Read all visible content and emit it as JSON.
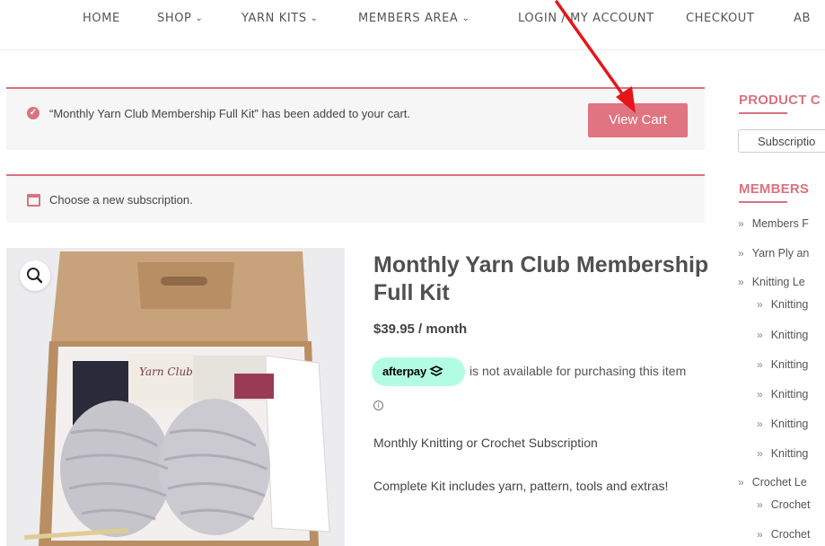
{
  "nav": {
    "items": [
      {
        "label": "HOME",
        "has_dropdown": false
      },
      {
        "label": "SHOP",
        "has_dropdown": true
      },
      {
        "label": "YARN KITS",
        "has_dropdown": true
      },
      {
        "label": "MEMBERS AREA",
        "has_dropdown": true
      },
      {
        "label": "LOGIN / MY ACCOUNT",
        "has_dropdown": false
      },
      {
        "label": "CHECKOUT",
        "has_dropdown": false
      },
      {
        "label": "AB",
        "has_dropdown": false
      }
    ],
    "dropdown_icon": "chevron-down-icon"
  },
  "notices": {
    "cart_added": {
      "text": "“Monthly Yarn Club Membership Full Kit” has been added to your cart.",
      "button_label": "View Cart",
      "icon": "check-circle-icon"
    },
    "subscription": {
      "text": "Choose a new subscription.",
      "icon": "calendar-icon"
    }
  },
  "product": {
    "title": "Monthly Yarn Club Membership Full Kit",
    "price": "$39.95 / month",
    "afterpay_logo": "afterpay",
    "afterpay_text": "is not available for purchasing this item",
    "info_glyph": "i",
    "description_1": "Monthly Knitting or Crochet Subscription",
    "description_2": "Complete Kit includes yarn, pattern, tools and extras!",
    "image_label": "Yarn Club",
    "zoom_icon": "magnifier-icon"
  },
  "sidebar": {
    "product_categories_title": "PRODUCT C",
    "category_select_value": "Subscriptio",
    "members_title": "MEMBERS",
    "links": [
      {
        "label": "Members F",
        "level": 0
      },
      {
        "label": "Yarn Ply an",
        "level": 0
      },
      {
        "label": "Knitting Le",
        "level": 0
      },
      {
        "label": "Knitting",
        "level": 1
      },
      {
        "label": "Knitting",
        "level": 1
      },
      {
        "label": "Knitting",
        "level": 1
      },
      {
        "label": "Knitting",
        "level": 1
      },
      {
        "label": "Knitting",
        "level": 1
      },
      {
        "label": "Knitting",
        "level": 1
      },
      {
        "label": "Crochet Le",
        "level": 0
      },
      {
        "label": "Crochet",
        "level": 1
      },
      {
        "label": "Crochet",
        "level": 1
      }
    ],
    "bullet_glyph": "»"
  },
  "colors": {
    "accent": "#d8737f",
    "button": "#e07480",
    "afterpay_mint": "#b2fce4",
    "annotation_arrow": "#e8141b"
  }
}
